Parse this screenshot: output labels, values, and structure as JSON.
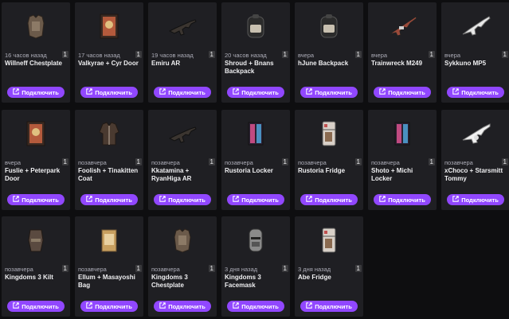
{
  "button_icon": "external-link-icon",
  "accent_color": "#9147ff",
  "cards": [
    {
      "time": "16 часов назад",
      "title": "Willneff Chestplate",
      "count": "1",
      "button": "Подключить",
      "icon": "chestplate-icon"
    },
    {
      "time": "17 часов назад",
      "title": "Valkyrae + Cyr Door",
      "count": "1",
      "button": "Подключить",
      "icon": "door-icon"
    },
    {
      "time": "19 часов назад",
      "title": "Emiru AR",
      "count": "1",
      "button": "Подключить",
      "icon": "rifle-icon"
    },
    {
      "time": "20 часов назад",
      "title": "Shroud + Bnans Backpack",
      "count": "1",
      "button": "Подключить",
      "icon": "backpack-icon"
    },
    {
      "time": "вчера",
      "title": "hJune Backpack",
      "count": "1",
      "button": "Подключить",
      "icon": "backpack-icon"
    },
    {
      "time": "вчера",
      "title": "Trainwreck M249",
      "count": "1",
      "button": "Подключить",
      "icon": "machine-gun-icon"
    },
    {
      "time": "вчера",
      "title": "Sykkuno MP5",
      "count": "1",
      "button": "Подключить",
      "icon": "smg-icon"
    },
    {
      "time": "вчера",
      "title": "Fuslie + Peterpark Door",
      "count": "1",
      "button": "Подключить",
      "icon": "door-icon"
    },
    {
      "time": "позавчера",
      "title": "Foolish + Tinakitten Coat",
      "count": "1",
      "button": "Подключить",
      "icon": "coat-icon"
    },
    {
      "time": "позавчера",
      "title": "Kkatamina + RyanHiga AR",
      "count": "1",
      "button": "Подключить",
      "icon": "rifle-icon"
    },
    {
      "time": "позавчера",
      "title": "Rustoria Locker",
      "count": "1",
      "button": "Подключить",
      "icon": "locker-icon"
    },
    {
      "time": "позавчера",
      "title": "Rustoria Fridge",
      "count": "1",
      "button": "Подключить",
      "icon": "fridge-icon"
    },
    {
      "time": "позавчера",
      "title": "Shoto + Michi Locker",
      "count": "1",
      "button": "Подключить",
      "icon": "locker-icon"
    },
    {
      "time": "позавчера",
      "title": "xChoco + Starsmitt Tommy",
      "count": "1",
      "button": "Подключить",
      "icon": "tommy-gun-icon"
    },
    {
      "time": "позавчера",
      "title": "Kingdoms 3 Kilt",
      "count": "1",
      "button": "Подключить",
      "icon": "kilt-icon"
    },
    {
      "time": "позавчера",
      "title": "Ellum + Masayoshi Bag",
      "count": "1",
      "button": "Подключить",
      "icon": "bag-icon"
    },
    {
      "time": "позавчера",
      "title": "Kingdoms 3 Chestplate",
      "count": "1",
      "button": "Подключить",
      "icon": "chestplate-icon"
    },
    {
      "time": "3 дня назад",
      "title": "Kingdoms 3 Facemask",
      "count": "1",
      "button": "Подключить",
      "icon": "facemask-icon"
    },
    {
      "time": "3 дня назад",
      "title": "Abe Fridge",
      "count": "1",
      "button": "Подключить",
      "icon": "fridge-icon"
    }
  ]
}
